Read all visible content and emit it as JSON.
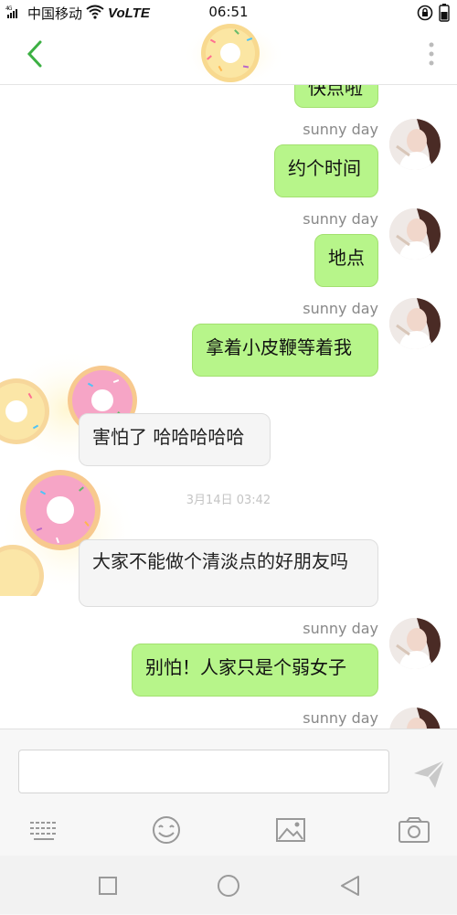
{
  "status_bar": {
    "signal": "4G",
    "carrier": "中国移动",
    "volte": "VoLTE",
    "time": "06:51"
  },
  "header": {
    "back_icon": "chevron-left-icon",
    "more_icon": "more-vertical-icon",
    "accent_color": "#3cb043"
  },
  "chat": {
    "partial_top_message": "快点啦",
    "messages": [
      {
        "direction": "out",
        "sender": "sunny day",
        "text": "约个时间"
      },
      {
        "direction": "out",
        "sender": "sunny day",
        "text": "地点"
      },
      {
        "direction": "out",
        "sender": "sunny day",
        "text": "拿着小皮鞭等着我"
      },
      {
        "direction": "in",
        "text": "害怕了 哈哈哈哈哈"
      },
      {
        "direction": "in",
        "text": "大家不能做个清淡点的好朋友吗"
      },
      {
        "direction": "out",
        "sender": "sunny day",
        "text": "别怕！人家只是个弱女子"
      },
      {
        "direction": "out",
        "sender": "sunny day",
        "text": ""
      }
    ],
    "timestamp": "3月14日 03:42",
    "outgoing_bubble_color": "#b7f58a",
    "incoming_bubble_color": "#f5f5f5"
  },
  "input": {
    "value": "",
    "placeholder": ""
  },
  "toolbar": {
    "icons": [
      "keyboard-icon",
      "emoji-icon",
      "image-icon",
      "camera-icon",
      "send-icon"
    ]
  },
  "navigation": {
    "icons": [
      "recent-apps-icon",
      "home-icon",
      "back-icon"
    ]
  }
}
